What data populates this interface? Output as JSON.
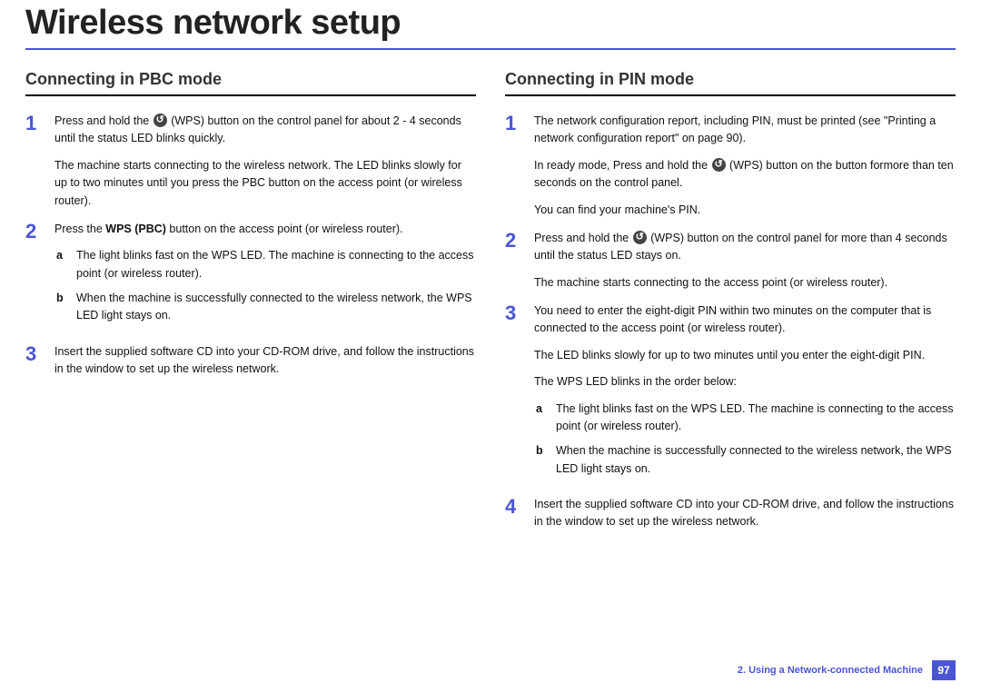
{
  "title": "Wireless network setup",
  "left": {
    "heading": "Connecting in PBC mode",
    "steps": [
      {
        "num": "1",
        "p1a": "Press and hold the ",
        "p1b": " (WPS) button on the control panel for about 2 - 4 seconds until the status LED blinks quickly.",
        "p2": "The machine starts connecting to the wireless network. The LED blinks slowly for up to two minutes until you press the PBC button on the access point (or wireless router)."
      },
      {
        "num": "2",
        "p1a": "Press the ",
        "p1bold": "WPS (PBC)",
        "p1b": " button on the access point (or wireless router).",
        "subs": [
          {
            "letter": "a",
            "text": "The light blinks fast on the WPS LED. The machine is connecting to the access point (or wireless router)."
          },
          {
            "letter": "b",
            "text": "When the machine is successfully connected to the wireless network, the WPS LED light stays on."
          }
        ]
      },
      {
        "num": "3",
        "p1": "Insert the supplied software CD into your CD-ROM drive, and follow the instructions in the window to set up the wireless network."
      }
    ]
  },
  "right": {
    "heading": "Connecting in PIN mode",
    "steps": [
      {
        "num": "1",
        "p1": "The network configuration report, including PIN, must be printed (see \"Printing a network configuration report\" on page 90).",
        "p2a": "In ready mode, Press and hold the ",
        "p2b": " (WPS) button on the button formore than ten seconds on the control panel.",
        "p3": "You can find your machine's PIN."
      },
      {
        "num": "2",
        "p1a": "Press and hold the ",
        "p1b": " (WPS) button on the control panel for more than 4 seconds until the status LED stays on.",
        "p2": "The machine starts connecting to the access point (or wireless router)."
      },
      {
        "num": "3",
        "p1": "You need to enter the eight-digit PIN within two minutes on the computer that is connected to the access point (or wireless router).",
        "p2": "The LED blinks slowly for up to two minutes until you enter the eight-digit PIN.",
        "p3": "The WPS LED blinks in the order below:",
        "subs": [
          {
            "letter": "a",
            "text": "The light blinks fast on the WPS LED. The machine is connecting to the access point (or wireless router)."
          },
          {
            "letter": "b",
            "text": "When the machine is successfully connected to the wireless network, the WPS LED light stays on."
          }
        ]
      },
      {
        "num": "4",
        "p1": "Insert the supplied software CD into your CD-ROM drive, and follow the instructions in the window to set up the wireless network."
      }
    ]
  },
  "footer": {
    "chapter": "2.  Using a Network-connected Machine",
    "page": "97"
  }
}
